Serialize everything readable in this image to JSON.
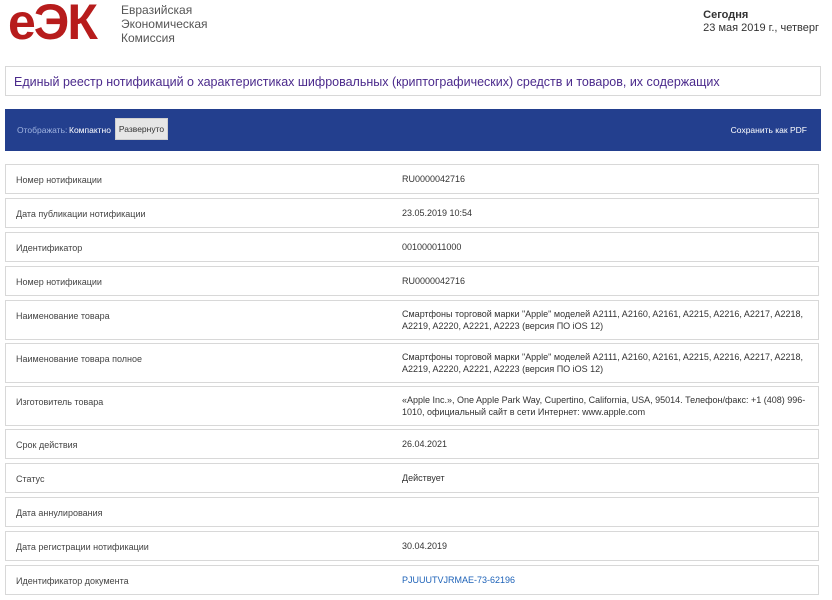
{
  "header": {
    "logo_text": "еЭК",
    "org_lines": [
      "Евразийская",
      "Экономическая",
      "Комиссия"
    ],
    "today_label": "Сегодня",
    "today_date": "23 мая 2019 г., четверг"
  },
  "page_title": "Единый реестр нотификаций о характеристиках шифровальных (криптографических) средств и товаров, их содержащих",
  "toolbar": {
    "show_label": "Отображать:",
    "compact_label": "Компактно",
    "expanded_label": "Развернуто",
    "save_pdf_label": "Сохранить как PDF"
  },
  "rows": [
    {
      "label": "Номер нотификации",
      "value": "RU0000042716"
    },
    {
      "label": "Дата публикации нотификации",
      "value": "23.05.2019 10:54"
    },
    {
      "label": "Идентификатор",
      "value": "001000011000"
    },
    {
      "label": "Номер нотификации",
      "value": "RU0000042716"
    },
    {
      "label": "Наименование товара",
      "value": "Смартфоны торговой марки \"Apple\" моделей A2111, A2160, A2161, A2215, A2216, A2217, A2218, A2219, A2220, A2221, A2223 (версия ПО iOS 12)"
    },
    {
      "label": "Наименование товара полное",
      "value": "Смартфоны торговой марки \"Apple\" моделей A2111, A2160, A2161, A2215, A2216, A2217, A2218, A2219, A2220, A2221, A2223 (версия ПО iOS 12)"
    },
    {
      "label": "Изготовитель товара",
      "value": "«Apple Inc.», One Apple Park Way, Cupertino, California, USA, 95014. Телефон/факс: +1 (408) 996-1010, официальный сайт в сети Интернет: www.apple.com"
    },
    {
      "label": "Срок действия",
      "value": "26.04.2021"
    },
    {
      "label": "Статус",
      "value": "Действует"
    },
    {
      "label": "Дата аннулирования",
      "value": ""
    },
    {
      "label": "Дата регистрации нотификации",
      "value": "30.04.2019"
    },
    {
      "label": "Идентификатор документа",
      "value": "PJUUUTVJRMAE-73-62196"
    }
  ]
}
